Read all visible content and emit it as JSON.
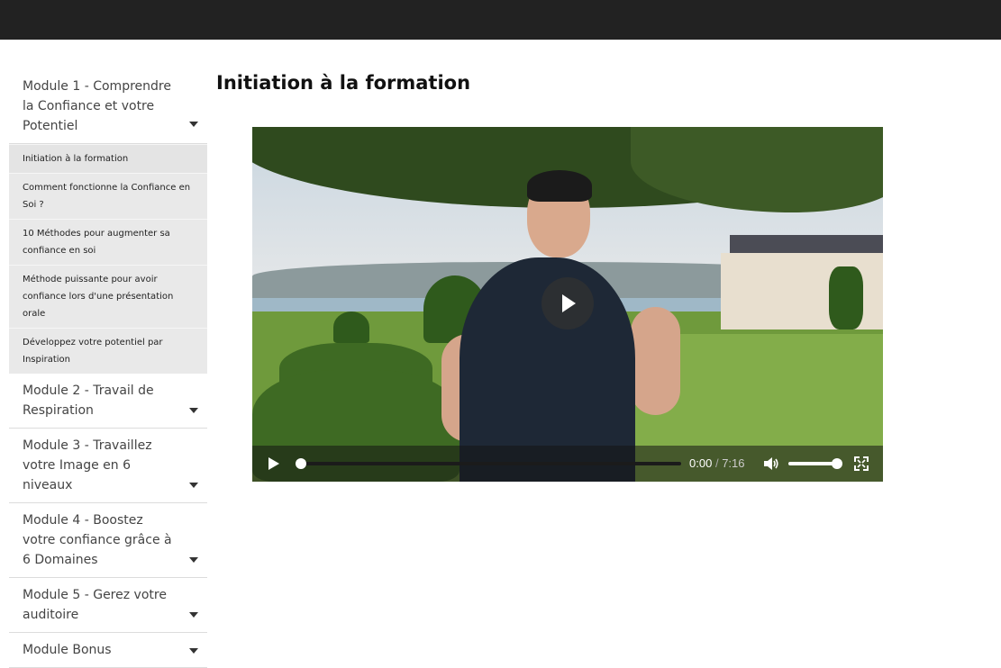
{
  "page": {
    "title": "Initiation à la formation"
  },
  "sidebar": {
    "modules": [
      {
        "label": "Module 1 - Comprendre la Confiance et votre Potentiel",
        "expanded": true,
        "lessons": [
          "Initiation à la formation",
          "Comment fonctionne la Confiance en Soi ?",
          "10 Méthodes pour augmenter sa confiance en soi",
          "Méthode puissante pour avoir confiance lors d'une présentation orale",
          "Développez votre potentiel par Inspiration"
        ]
      },
      {
        "label": "Module 2 - Travail de Respiration",
        "expanded": false
      },
      {
        "label": "Module 3 - Travaillez votre Image en 6 niveaux",
        "expanded": false
      },
      {
        "label": "Module 4 - Boostez votre confiance grâce à 6 Domaines",
        "expanded": false
      },
      {
        "label": "Module 5 - Gerez votre auditoire",
        "expanded": false
      },
      {
        "label": "Module Bonus",
        "expanded": false
      }
    ]
  },
  "video": {
    "current_time": "0:00",
    "separator": "/",
    "duration": "7:16",
    "progress_fraction": 0,
    "volume_fraction": 0.9
  },
  "icons": {
    "play": "play-icon",
    "big_play": "big-play-icon",
    "volume": "volume-icon",
    "fullscreen": "fullscreen-icon",
    "caret": "chevron-down-icon"
  }
}
